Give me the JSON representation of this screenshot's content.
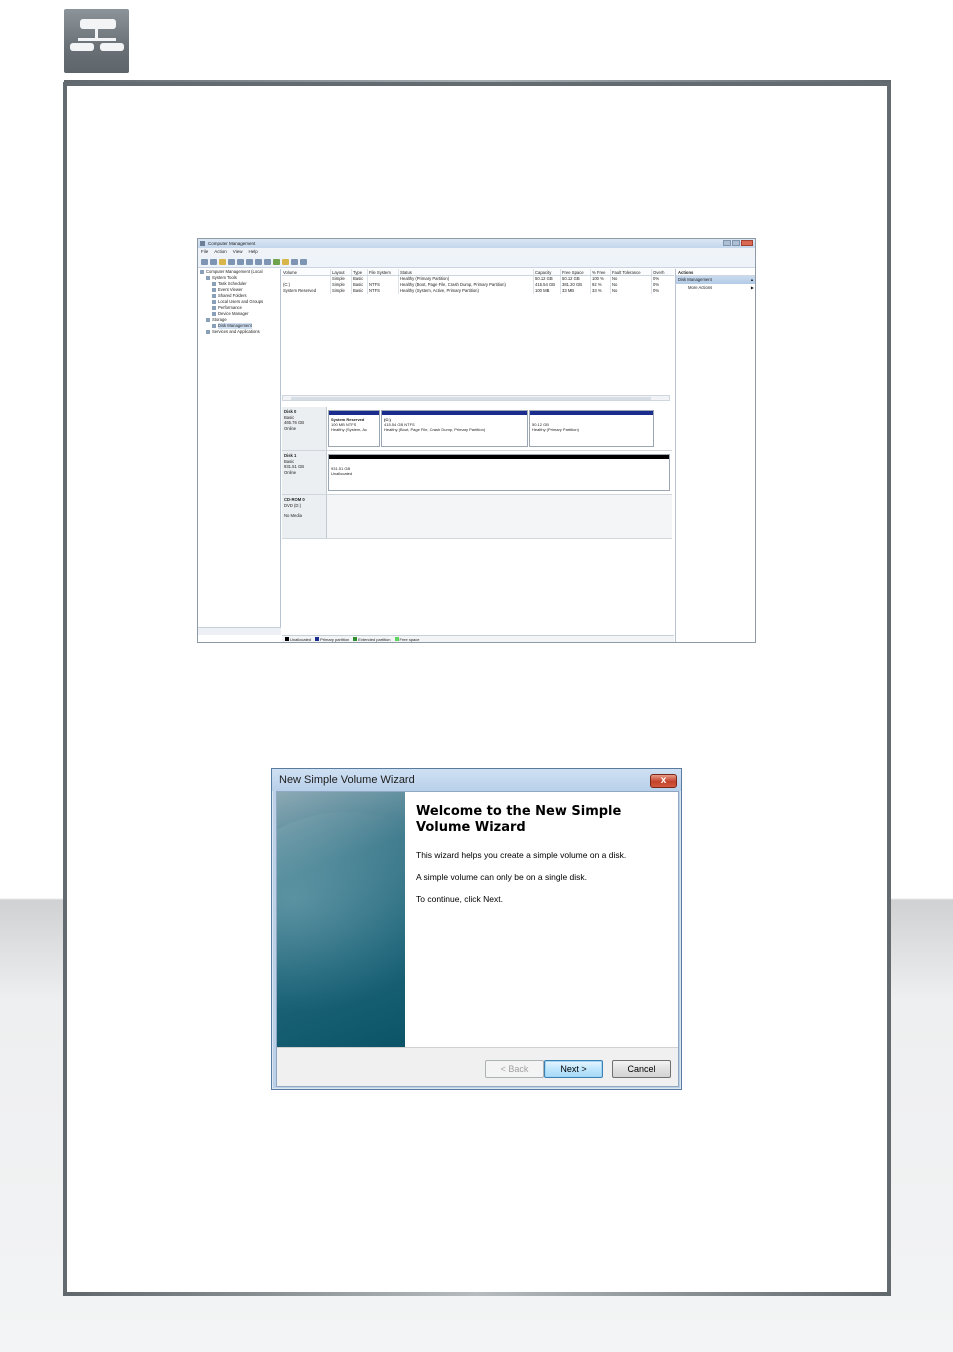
{
  "computer_management": {
    "title": "Computer Management",
    "menu": [
      "File",
      "Action",
      "View",
      "Help"
    ],
    "tree": [
      {
        "label": "Computer Management (Local",
        "indent": 0
      },
      {
        "label": "System Tools",
        "indent": 1
      },
      {
        "label": "Task Scheduler",
        "indent": 2
      },
      {
        "label": "Event Viewer",
        "indent": 2
      },
      {
        "label": "Shared Folders",
        "indent": 2
      },
      {
        "label": "Local Users and Groups",
        "indent": 2
      },
      {
        "label": "Performance",
        "indent": 2
      },
      {
        "label": "Device Manager",
        "indent": 2
      },
      {
        "label": "Storage",
        "indent": 1
      },
      {
        "label": "Disk Management",
        "indent": 2,
        "selected": true
      },
      {
        "label": "Services and Applications",
        "indent": 1
      }
    ],
    "volume_columns": [
      "Volume",
      "Layout",
      "Type",
      "File System",
      "Status",
      "Capacity",
      "Free Space",
      "% Free",
      "Fault Tolerance",
      "Overh"
    ],
    "volume_rows": [
      [
        "",
        "Simple",
        "Basic",
        "",
        "Healthy (Primary Partition)",
        "50.12 GB",
        "50.12 GB",
        "100 %",
        "No",
        "0%"
      ],
      [
        "(C:)",
        "Simple",
        "Basic",
        "NTFS",
        "Healthy (Boot, Page File, Crash Dump, Primary Partition)",
        "415.54 GB",
        "381.20 GB",
        "92 %",
        "No",
        "0%"
      ],
      [
        "System Reserved",
        "Simple",
        "Basic",
        "NTFS",
        "Healthy (System, Active, Primary Partition)",
        "100 MB",
        "33 MB",
        "33 %",
        "No",
        "0%"
      ]
    ],
    "disks": [
      {
        "name": "Disk 0",
        "type": "Basic",
        "size": "465.76 GB",
        "state": "Online",
        "partitions": [
          {
            "title": "System Reserved",
            "size": "100 MB NTFS",
            "status": "Healthy (System, Ac"
          },
          {
            "title": "(C:)",
            "size": "415.54 GB NTFS",
            "status": "Healthy (Boot, Page File, Crash Dump, Primary Partition)"
          },
          {
            "title": "",
            "size": "50.12 GB",
            "status": "Healthy (Primary Partition)"
          }
        ]
      },
      {
        "name": "Disk 1",
        "type": "Basic",
        "size": "931.51 GB",
        "state": "Online",
        "partitions": [
          {
            "title": "",
            "size": "931.51 GB",
            "status": "Unallocated"
          }
        ]
      },
      {
        "name": "CD-ROM 0",
        "type": "DVD (D:)",
        "size": "",
        "state": "No Media",
        "partitions": []
      }
    ],
    "legend": [
      {
        "label": "Unallocated",
        "color": "#000000"
      },
      {
        "label": "Primary partition",
        "color": "#1a2d8f"
      },
      {
        "label": "Extended partition",
        "color": "#2f8f2f"
      },
      {
        "label": "Free space",
        "color": "#5fd35f"
      }
    ],
    "actions": {
      "header": "Actions",
      "section": "Disk Management",
      "more": "More Actions"
    }
  },
  "wizard": {
    "title": "New Simple Volume Wizard",
    "close_label": "x",
    "heading": "Welcome to the New Simple Volume Wizard",
    "lines": [
      "This wizard helps you create a simple volume on a disk.",
      "A simple volume can only be on a single disk.",
      "To continue, click Next."
    ],
    "buttons": {
      "back": "< Back",
      "next": "Next >",
      "cancel": "Cancel"
    }
  }
}
